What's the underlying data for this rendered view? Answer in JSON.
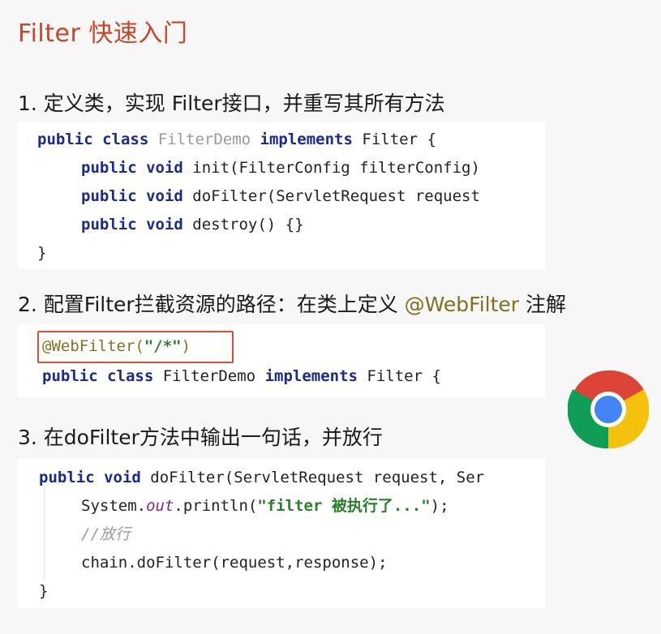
{
  "title": "Filter 快速入门",
  "steps": [
    {
      "text": "1. 定义类，实现 Filter接口，并重写其所有方法"
    },
    {
      "text_before": "2. 配置Filter拦截资源的路径：在类上定义 ",
      "annotation": "@WebFilter",
      "text_after": " 注解"
    },
    {
      "text": "3. 在doFilter方法中输出一句话，并放行"
    }
  ],
  "code1": {
    "l1_kw": "public class ",
    "l1_name": "FilterDemo",
    "l1_kw2": " implements",
    "l1_rest": " Filter {",
    "l2_kw": "public void",
    "l2_rest": " init(FilterConfig filterConfig)",
    "l3_kw": "public void",
    "l3_rest": " doFilter(ServletRequest request",
    "l4_kw": "public void",
    "l4_rest": " destroy() {}",
    "l5": "}"
  },
  "code2": {
    "annotation": "@WebFilter(",
    "string": "\"/*\"",
    "close": ")",
    "l2_kw": "public class",
    "l2_mid": " FilterDemo ",
    "l2_kw2": "implements",
    "l2_rest": " Filter {"
  },
  "code3": {
    "l1_kw": "public void",
    "l1_rest": " doFilter(ServletRequest request, Ser",
    "l2_a": "System.",
    "l2_field": "out",
    "l2_b": ".println(",
    "l2_str": "\"filter 被执行了...\"",
    "l2_c": ");",
    "l3_comment": "//放行",
    "l4": "chain.doFilter(request,response);",
    "l5": "}"
  },
  "icons": {
    "browser": "chrome-logo-icon"
  },
  "colors": {
    "title": "#c8452a",
    "keyword": "#1c2a8c",
    "annotation": "#807020",
    "highlight_box": "#d9513a"
  }
}
